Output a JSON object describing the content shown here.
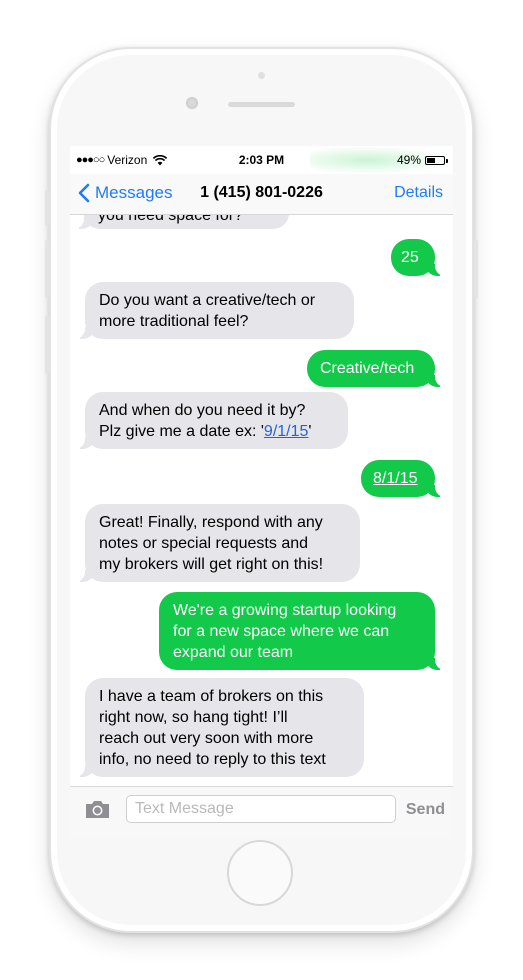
{
  "status_bar": {
    "signal": "●●●○○",
    "carrier": "Verizon",
    "time": "2:03 PM",
    "battery_percent": "49%",
    "battery_level": 0.49
  },
  "nav": {
    "back_label": "Messages",
    "title": "1 (415) 801-0226",
    "details_label": "Details"
  },
  "messages": [
    {
      "from": "them",
      "lines": [
        "you need space for?"
      ]
    },
    {
      "from": "me",
      "lines": [
        "25"
      ]
    },
    {
      "from": "them",
      "lines": [
        "Do you want a creative/tech or",
        "more traditional feel?"
      ]
    },
    {
      "from": "me",
      "lines": [
        "Creative/tech"
      ]
    },
    {
      "from": "them",
      "lines_before_link": "And when do you need it by?",
      "line2_prefix": "Plz give me a date ex: '",
      "line2_link": "9/1/15",
      "line2_suffix": "'"
    },
    {
      "from": "me",
      "link": "8/1/15"
    },
    {
      "from": "them",
      "lines": [
        "Great! Finally, respond with any",
        "notes or special requests and",
        "my brokers will get right on this!"
      ]
    },
    {
      "from": "me",
      "lines": [
        "We're a growing startup looking",
        "for a new space where we can",
        "expand our team"
      ]
    },
    {
      "from": "them",
      "lines": [
        "I have a team of brokers on this",
        "right now, so hang tight! I’ll",
        "reach out very soon with more",
        "info, no need to reply to this text"
      ]
    }
  ],
  "composer": {
    "placeholder": "Text Message",
    "send_label": "Send"
  },
  "colors": {
    "incoming_bubble": "#e5e5ea",
    "outgoing_bubble": "#13c94a",
    "accent": "#1f7cf6"
  }
}
